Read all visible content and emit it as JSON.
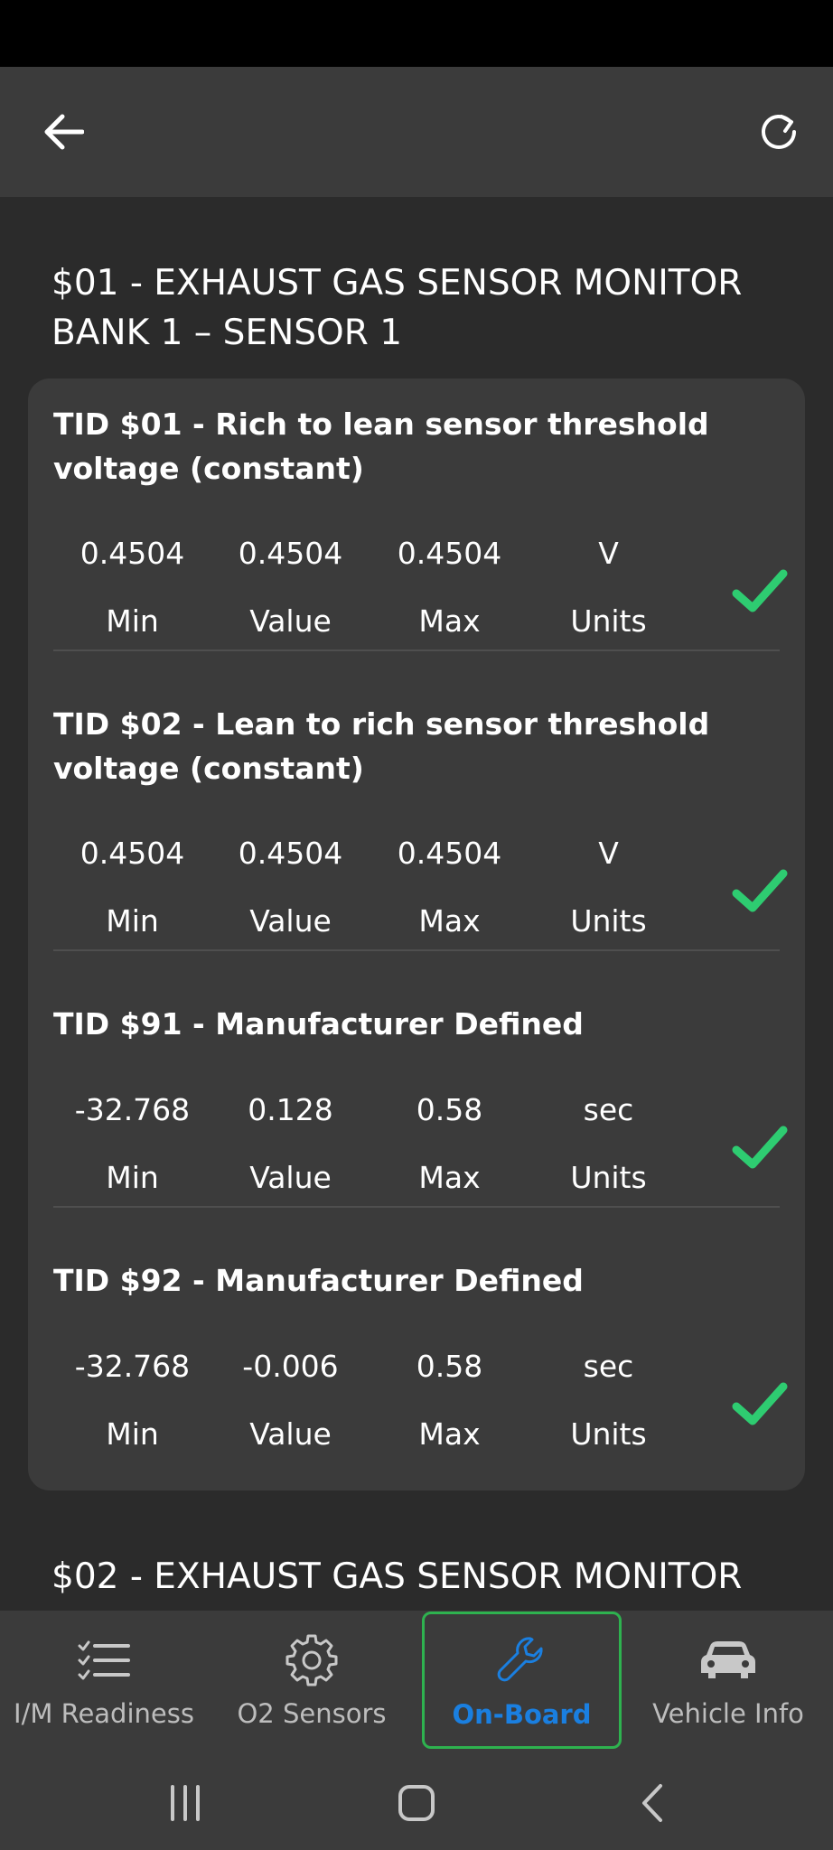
{
  "colors": {
    "background": "#2b2b2b",
    "surface": "#3b3b3b",
    "check": "#2ecc71",
    "active_tab": "#1a7fe0",
    "active_border": "#2eb24f"
  },
  "app_bar": {
    "back_icon": "arrow-left-icon",
    "refresh_icon": "refresh-icon"
  },
  "sections": [
    {
      "title_line1": "$01 - EXHAUST GAS SENSOR MONITOR",
      "title_line2": "BANK 1 – SENSOR 1",
      "tests": [
        {
          "title": "TID $01 - Rich to lean sensor threshold voltage (constant)",
          "min": "0.4504",
          "value": "0.4504",
          "max": "0.4504",
          "units": "V",
          "status": "pass"
        },
        {
          "title": "TID $02 - Lean to rich sensor threshold voltage (constant)",
          "min": "0.4504",
          "value": "0.4504",
          "max": "0.4504",
          "units": "V",
          "status": "pass"
        },
        {
          "title": "TID $91 - Manufacturer Defined",
          "min": "-32.768",
          "value": "0.128",
          "max": "0.58",
          "units": "sec",
          "status": "pass"
        },
        {
          "title": "TID $92 - Manufacturer Defined",
          "min": "-32.768",
          "value": "-0.006",
          "max": "0.58",
          "units": "sec",
          "status": "pass"
        }
      ]
    },
    {
      "title_line1": "$02 - EXHAUST GAS SENSOR MONITOR"
    }
  ],
  "labels": {
    "min": "Min",
    "value": "Value",
    "max": "Max",
    "units": "Units"
  },
  "bottom_nav": [
    {
      "label": "I/M Readiness",
      "icon": "checklist-icon",
      "active": false
    },
    {
      "label": "O2 Sensors",
      "icon": "gear-icon",
      "active": false
    },
    {
      "label": "On-Board",
      "icon": "wrench-icon",
      "active": true
    },
    {
      "label": "Vehicle Info",
      "icon": "car-icon",
      "active": false
    }
  ],
  "system_nav": [
    "recents-button",
    "home-button",
    "back-button"
  ]
}
